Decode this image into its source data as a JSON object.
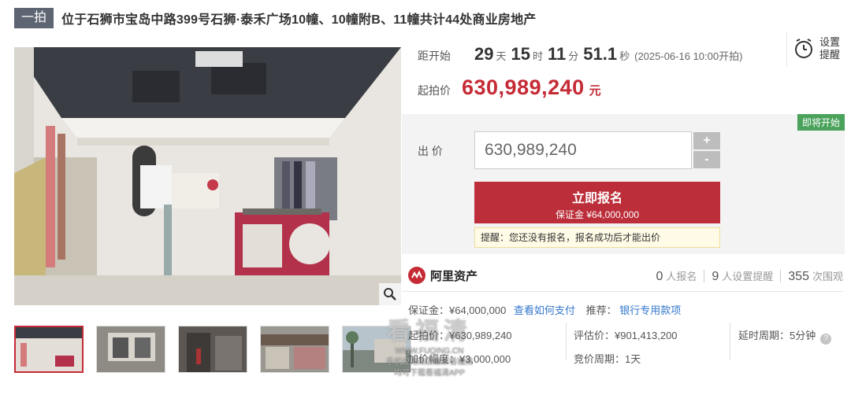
{
  "header": {
    "badge": "一拍",
    "title": "位于石狮市宝岛中路399号石狮·泰禾广场10幢、10幢附B、11幢共计44处商业房地产"
  },
  "countdown": {
    "label": "距开始",
    "days": "29",
    "days_unit": "天",
    "hours": "15",
    "hours_unit": "时",
    "minutes": "11",
    "minutes_unit": "分",
    "seconds": "51.1",
    "seconds_unit": "秒",
    "start_time": "(2025-06-16 10:00开拍)"
  },
  "reminder": {
    "label": "设置提醒",
    "icon": "alarm-clock-icon"
  },
  "starting_price": {
    "label": "起拍价",
    "value": "630,989,240",
    "unit": "元"
  },
  "bid": {
    "status_tag": "即将开始",
    "label": "出 价",
    "input_value": "630,989,240",
    "plus": "+",
    "minus": "-",
    "register_label": "立即报名",
    "deposit_line": "保证金 ¥64,000,000",
    "tip": "提醒：您还没有报名，报名成功后才能出价"
  },
  "platform": {
    "name": "阿里资产"
  },
  "stats": {
    "registered_num": "0",
    "registered_label": "人报名",
    "reminder_num": "9",
    "reminder_label": "人设置提醒",
    "views_num": "355",
    "views_label": "次围观"
  },
  "details": {
    "deposit": "保证金：¥64,000,000",
    "how_to_pay": "查看如何支付",
    "recommend_label": "推荐：",
    "recommend_link": "银行专用款项",
    "starting_price": "起拍价：¥630,989,240",
    "valuation": "评估价：¥901,413,200",
    "delay_period": "延时周期：5分钟",
    "increment": "加价幅度：¥3,000,000",
    "auction_period": "竞价周期：1天"
  },
  "watermark": {
    "big": "看福清",
    "line1": "WWW.FUQING.CN",
    "line2": "手机应用商店搜索看福清",
    "line3": "均可下载看福清APP"
  },
  "colors": {
    "accent_red": "#bb2e3a",
    "price_red": "#c52b35",
    "badge_gray": "#5d6472",
    "tag_green": "#4aa25b",
    "link_blue": "#3377cc"
  }
}
